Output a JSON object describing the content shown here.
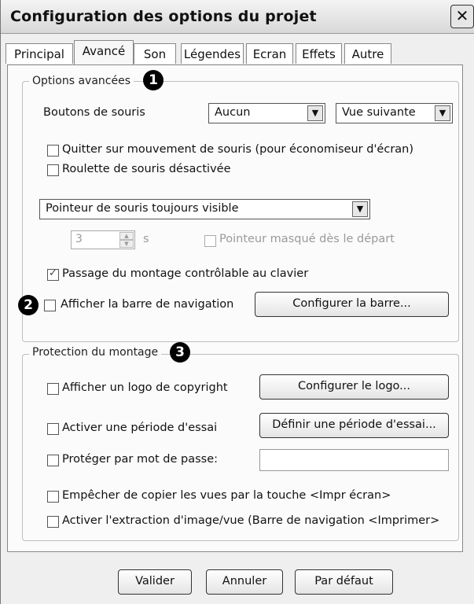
{
  "window": {
    "title": "Configuration des options du projet",
    "close_glyph": "✕"
  },
  "tabs": [
    {
      "label": "Principal",
      "active": false
    },
    {
      "label": "Avancé",
      "active": true
    },
    {
      "label": "Son",
      "active": false
    },
    {
      "label": "Légendes",
      "active": false
    },
    {
      "label": "Ecran",
      "active": false
    },
    {
      "label": "Effets",
      "active": false
    },
    {
      "label": "Autre",
      "active": false
    }
  ],
  "advanced": {
    "group_title": "Options avancées",
    "badge1": "1",
    "mouse_buttons_label": "Boutons de souris",
    "mouse_left_select": "Aucun",
    "mouse_right_select": "Vue suivante",
    "quit_on_mouse_label": "Quitter sur mouvement de souris (pour économiseur d'écran)",
    "quit_on_mouse_checked": false,
    "wheel_disabled_label": "Roulette de souris désactivée",
    "wheel_disabled_checked": false,
    "pointer_select": "Pointeur de souris toujours visible",
    "pointer_delay_value": "3",
    "pointer_delay_unit": "s",
    "pointer_hidden_label": "Pointeur masqué dès le départ",
    "pointer_hidden_checked": false,
    "keyboard_label": "Passage du montage contrôlable au clavier",
    "keyboard_checked": true,
    "badge2": "2",
    "navbar_label": "Afficher la barre de navigation",
    "navbar_checked": false,
    "configure_bar_button": "Configurer la barre..."
  },
  "protection": {
    "group_title": "Protection du montage",
    "badge3": "3",
    "logo_label": "Afficher un logo de copyright",
    "logo_checked": false,
    "configure_logo_button": "Configurer le logo...",
    "trial_label": "Activer une période d'essai",
    "trial_checked": false,
    "define_trial_button": "Définir une période d'essai...",
    "password_label": "Protéger par mot de passe:",
    "password_checked": false,
    "password_value": "",
    "print_screen_label": "Empêcher de copier les vues par la touche <Impr écran>",
    "print_screen_checked": false,
    "extraction_label": "Activer l'extraction d'image/vue (Barre de navigation <Imprimer>",
    "extraction_checked": false
  },
  "footer": {
    "ok_button": "Valider",
    "cancel_button": "Annuler",
    "default_button": "Par défaut"
  },
  "icons": {
    "dropdown_arrow": "▼",
    "spin_up": "▲",
    "spin_down": "▼"
  }
}
